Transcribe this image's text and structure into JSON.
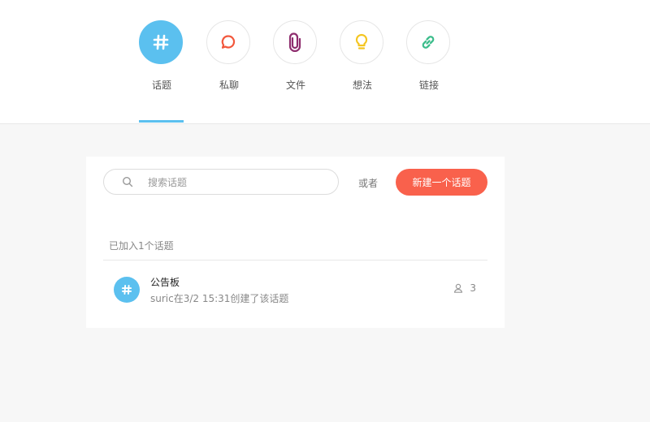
{
  "nav": {
    "tabs": [
      {
        "label": "话题",
        "icon": "hashtag-icon",
        "color": "#5bc0ef",
        "active": true
      },
      {
        "label": "私聊",
        "icon": "chat-bubble-icon",
        "color": "#f2573c",
        "active": false
      },
      {
        "label": "文件",
        "icon": "paperclip-icon",
        "color": "#8e2d6e",
        "active": false
      },
      {
        "label": "想法",
        "icon": "lightbulb-icon",
        "color": "#f4c520",
        "active": false
      },
      {
        "label": "链接",
        "icon": "link-icon",
        "color": "#3dbd8c",
        "active": false
      }
    ]
  },
  "search": {
    "placeholder": "搜索话题",
    "or_label": "或者",
    "new_button_label": "新建一个话题"
  },
  "topics": {
    "section_title": "已加入1个话题",
    "items": [
      {
        "name": "公告板",
        "meta": "suric在3/2 15:31创建了该话题",
        "member_count": "3"
      }
    ]
  },
  "colors": {
    "accent": "#5bc0ef",
    "primary_button": "#f9614c",
    "background": "#f7f7f7"
  }
}
